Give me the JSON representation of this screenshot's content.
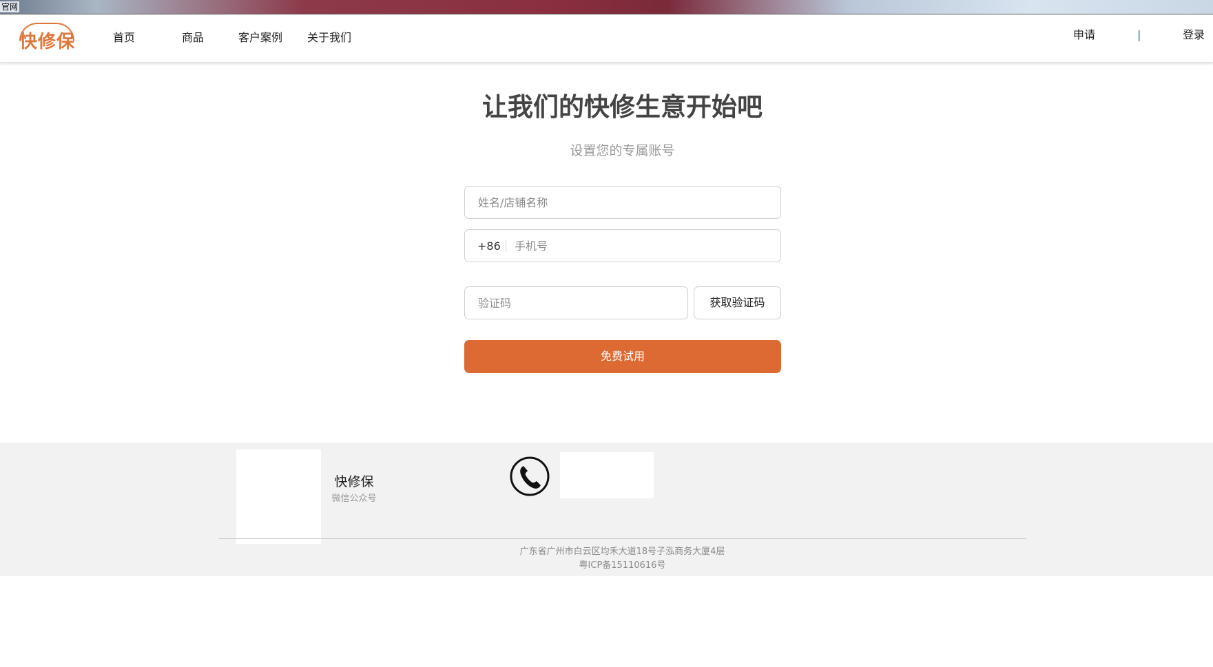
{
  "window": {
    "title": "官网"
  },
  "header": {
    "logo_text": "快修保",
    "nav": [
      {
        "label": "首页"
      },
      {
        "label": "商品"
      },
      {
        "label": "客户案例"
      },
      {
        "label": "关于我们"
      }
    ],
    "apply_label": "申请",
    "separator": "|",
    "login_label": "登录"
  },
  "form": {
    "title": "让我们的快修生意开始吧",
    "subtitle": "设置您的专属账号",
    "name_placeholder": "姓名/店铺名称",
    "phone_prefix": "+86",
    "phone_placeholder": "手机号",
    "code_placeholder": "验证码",
    "code_button_label": "获取验证码",
    "submit_label": "免费试用"
  },
  "footer": {
    "qr_title": "快修保",
    "qr_subtitle": "微信公众号",
    "address": "广东省广州市白云区均禾大道18号子泓商务大厦4层",
    "icp": "粤ICP备15110616号"
  },
  "colors": {
    "accent": "#dd6a33",
    "logo": "#e0773a",
    "footer_bg": "#f2f2f2"
  }
}
